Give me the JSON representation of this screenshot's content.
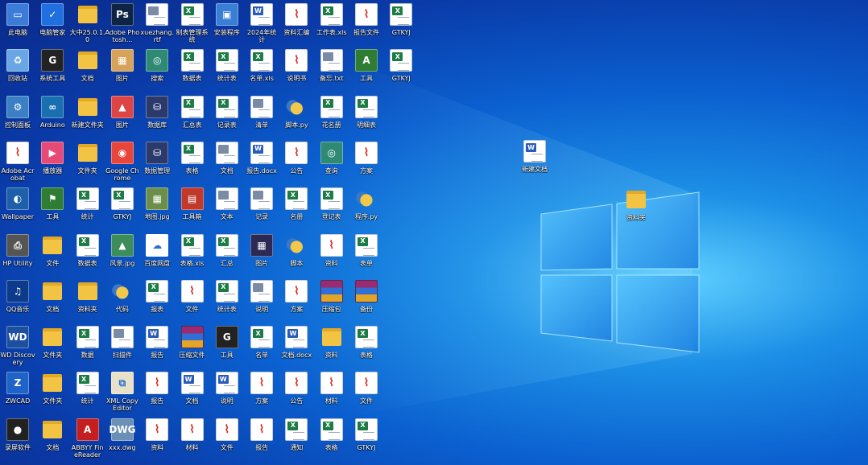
{
  "desktop": {
    "grid": [
      [
        {
          "label": "此电脑",
          "icon": "computer-icon",
          "kind": "app",
          "bg": "#3d7bd9",
          "sym": "▭"
        },
        {
          "label": "电脑管家",
          "icon": "shield-icon",
          "kind": "app",
          "bg": "#1f6fe0",
          "sym": "✓"
        },
        {
          "label": "大中25.0.1.0",
          "icon": "folder-icon",
          "kind": "folder"
        },
        {
          "label": "Adobe Photosh...",
          "icon": "photoshop-icon",
          "kind": "app",
          "bg": "#0e2444",
          "sym": "Ps"
        },
        {
          "label": "xuezhang.rtf",
          "icon": "document-icon",
          "kind": "doc",
          "badge": "",
          "badgeColor": "#7a8ba6"
        },
        {
          "label": "制表管理系统",
          "icon": "excel-icon",
          "kind": "doc",
          "badge": "X",
          "badgeColor": "#1d7c45"
        },
        {
          "label": "安装程序",
          "icon": "installer-icon",
          "kind": "app",
          "bg": "#3a7fd6",
          "sym": "▣"
        },
        {
          "label": "2024年统计",
          "icon": "word-icon",
          "kind": "doc",
          "badge": "W",
          "badgeColor": "#2b5bb8"
        },
        {
          "label": "资料汇编",
          "icon": "pdf-icon",
          "kind": "pdf"
        },
        {
          "label": "工作表.xls",
          "icon": "excel-icon",
          "kind": "doc",
          "badge": "X",
          "badgeColor": "#1d7c45"
        },
        {
          "label": "报告文件",
          "icon": "pdf-icon",
          "kind": "pdf"
        },
        {
          "label": "GTKYJ",
          "icon": "excel-icon",
          "kind": "doc",
          "badge": "X",
          "badgeColor": "#1d7c45"
        }
      ],
      [
        {
          "label": "回收站",
          "icon": "recycle-bin-icon",
          "kind": "app",
          "bg": "#6aa6e6",
          "sym": "♻"
        },
        {
          "label": "系统工具",
          "icon": "tool-icon",
          "kind": "app",
          "bg": "#222",
          "sym": "G"
        },
        {
          "label": "文档",
          "icon": "folder-icon",
          "kind": "folder"
        },
        {
          "label": "图片",
          "icon": "image-icon",
          "kind": "app",
          "bg": "#d7a35a",
          "sym": "▦"
        },
        {
          "label": "搜索",
          "icon": "search-icon",
          "kind": "app",
          "bg": "#2f8a74",
          "sym": "◎"
        },
        {
          "label": "数据表",
          "icon": "excel-icon",
          "kind": "doc",
          "badge": "X",
          "badgeColor": "#1d7c45"
        },
        {
          "label": "统计表",
          "icon": "excel-icon",
          "kind": "doc",
          "badge": "X",
          "badgeColor": "#1d7c45"
        },
        {
          "label": "名单.xls",
          "icon": "excel-icon",
          "kind": "doc",
          "badge": "X",
          "badgeColor": "#1d7c45"
        },
        {
          "label": "说明书",
          "icon": "pdf-icon",
          "kind": "pdf"
        },
        {
          "label": "备忘.txt",
          "icon": "text-icon",
          "kind": "doc",
          "badge": "",
          "badgeColor": "#7a8ba6"
        },
        {
          "label": "工具",
          "icon": "app-icon",
          "kind": "app",
          "bg": "#2e7d32",
          "sym": "A"
        },
        {
          "label": "GTKYJ",
          "icon": "excel-icon",
          "kind": "doc",
          "badge": "X",
          "badgeColor": "#1d7c45"
        }
      ],
      [
        {
          "label": "控制面板",
          "icon": "control-panel-icon",
          "kind": "app",
          "bg": "#3b7fc4",
          "sym": "⚙"
        },
        {
          "label": "Arduino",
          "icon": "infinity-icon",
          "kind": "app",
          "bg": "#1a6fb0",
          "sym": "∞"
        },
        {
          "label": "新建文件夹",
          "icon": "folder-icon",
          "kind": "folder"
        },
        {
          "label": "图片",
          "icon": "image-icon",
          "kind": "app",
          "bg": "#d44",
          "sym": "▲"
        },
        {
          "label": "数据库",
          "icon": "database-icon",
          "kind": "app",
          "bg": "#2b3a6b",
          "sym": "⛁"
        },
        {
          "label": "汇总表",
          "icon": "excel-icon",
          "kind": "doc",
          "badge": "X",
          "badgeColor": "#1d7c45"
        },
        {
          "label": "记录表",
          "icon": "excel-icon",
          "kind": "doc",
          "badge": "X",
          "badgeColor": "#1d7c45"
        },
        {
          "label": "清单",
          "icon": "document-icon",
          "kind": "doc",
          "badge": "",
          "badgeColor": "#7a8ba6"
        },
        {
          "label": "脚本.py",
          "icon": "python-icon",
          "kind": "py"
        },
        {
          "label": "花名册",
          "icon": "excel-icon",
          "kind": "doc",
          "badge": "X",
          "badgeColor": "#1d7c45"
        },
        {
          "label": "明细表",
          "icon": "excel-icon",
          "kind": "doc",
          "badge": "X",
          "badgeColor": "#1d7c45"
        }
      ],
      [
        {
          "label": "Adobe Acrobat",
          "icon": "acrobat-icon",
          "kind": "pdf"
        },
        {
          "label": "播放器",
          "icon": "player-icon",
          "kind": "app",
          "bg": "#e84a78",
          "sym": "▶"
        },
        {
          "label": "文件夹",
          "icon": "folder-icon",
          "kind": "folder"
        },
        {
          "label": "Google Chrome",
          "icon": "chrome-icon",
          "kind": "app",
          "bg": "#e8453c",
          "sym": "◉"
        },
        {
          "label": "数据管理",
          "icon": "database-icon",
          "kind": "app",
          "bg": "#2b3a6b",
          "sym": "⛁"
        },
        {
          "label": "表格",
          "icon": "excel-icon",
          "kind": "doc",
          "badge": "X",
          "badgeColor": "#1d7c45"
        },
        {
          "label": "文档",
          "icon": "document-icon",
          "kind": "doc",
          "badge": "",
          "badgeColor": "#7a8ba6"
        },
        {
          "label": "报告.docx",
          "icon": "word-icon",
          "kind": "doc",
          "badge": "W",
          "badgeColor": "#2b5bb8"
        },
        {
          "label": "公告",
          "icon": "pdf-icon",
          "kind": "pdf"
        },
        {
          "label": "查询",
          "icon": "search-icon",
          "kind": "app",
          "bg": "#2f8a74",
          "sym": "◎"
        },
        {
          "label": "方案",
          "icon": "pdf-icon",
          "kind": "pdf"
        }
      ],
      [
        {
          "label": "Wallpaper",
          "icon": "wallpaper-icon",
          "kind": "app",
          "bg": "#1d5fa8",
          "sym": "◐"
        },
        {
          "label": "工具",
          "icon": "app-icon",
          "kind": "app",
          "bg": "#2e7d32",
          "sym": "⚑"
        },
        {
          "label": "统计",
          "icon": "excel-icon",
          "kind": "doc",
          "badge": "X",
          "badgeColor": "#1d7c45"
        },
        {
          "label": "GTKYJ",
          "icon": "excel-icon",
          "kind": "doc",
          "badge": "X",
          "badgeColor": "#1d7c45"
        },
        {
          "label": "地图.jpg",
          "icon": "image-icon",
          "kind": "app",
          "bg": "#6b8f4a",
          "sym": "▦"
        },
        {
          "label": "工具箱",
          "icon": "toolbox-icon",
          "kind": "app",
          "bg": "#c0392b",
          "sym": "▤"
        },
        {
          "label": "文本",
          "icon": "document-icon",
          "kind": "doc",
          "badge": "",
          "badgeColor": "#7a8ba6"
        },
        {
          "label": "记录",
          "icon": "document-icon",
          "kind": "doc",
          "badge": "",
          "badgeColor": "#7a8ba6"
        },
        {
          "label": "名册",
          "icon": "excel-icon",
          "kind": "doc",
          "badge": "X",
          "badgeColor": "#1d7c45"
        },
        {
          "label": "登记表",
          "icon": "excel-icon",
          "kind": "doc",
          "badge": "X",
          "badgeColor": "#1d7c45"
        },
        {
          "label": "程序.py",
          "icon": "python-icon",
          "kind": "py"
        }
      ],
      [
        {
          "label": "HP Utility",
          "icon": "printer-icon",
          "kind": "app",
          "bg": "#555",
          "sym": "⎙"
        },
        {
          "label": "文件",
          "icon": "folder-icon",
          "kind": "folder"
        },
        {
          "label": "数据表",
          "icon": "excel-icon",
          "kind": "doc",
          "badge": "X",
          "badgeColor": "#1d7c45"
        },
        {
          "label": "风景.jpg",
          "icon": "image-icon",
          "kind": "app",
          "bg": "#3c8d5a",
          "sym": "▲"
        },
        {
          "label": "百度网盘",
          "icon": "cloud-icon",
          "kind": "app",
          "bg": "#fff",
          "sym": "☁"
        },
        {
          "label": "表格.xls",
          "icon": "excel-icon",
          "kind": "doc",
          "badge": "X",
          "badgeColor": "#1d7c45"
        },
        {
          "label": "汇总",
          "icon": "excel-icon",
          "kind": "doc",
          "badge": "X",
          "badgeColor": "#1d7c45"
        },
        {
          "label": "图片",
          "icon": "image-icon",
          "kind": "app",
          "bg": "#2a2a55",
          "sym": "▦"
        },
        {
          "label": "脚本",
          "icon": "python-icon",
          "kind": "py"
        },
        {
          "label": "资料",
          "icon": "pdf-icon",
          "kind": "pdf"
        },
        {
          "label": "表单",
          "icon": "excel-icon",
          "kind": "doc",
          "badge": "X",
          "badgeColor": "#1d7c45"
        }
      ],
      [
        {
          "label": "QQ音乐",
          "icon": "music-icon",
          "kind": "app",
          "bg": "#0b3b8a",
          "sym": "♫"
        },
        {
          "label": "文档",
          "icon": "folder-icon",
          "kind": "folder"
        },
        {
          "label": "资料夹",
          "icon": "folder-icon",
          "kind": "folder"
        },
        {
          "label": "代码",
          "icon": "python-icon",
          "kind": "py"
        },
        {
          "label": "报表",
          "icon": "excel-icon",
          "kind": "doc",
          "badge": "X",
          "badgeColor": "#1d7c45"
        },
        {
          "label": "文件",
          "icon": "pdf-icon",
          "kind": "pdf"
        },
        {
          "label": "统计表",
          "icon": "excel-icon",
          "kind": "doc",
          "badge": "X",
          "badgeColor": "#1d7c45"
        },
        {
          "label": "说明",
          "icon": "document-icon",
          "kind": "doc",
          "badge": "",
          "badgeColor": "#7a8ba6"
        },
        {
          "label": "方案",
          "icon": "pdf-icon",
          "kind": "pdf"
        },
        {
          "label": "压缩包",
          "icon": "zip-icon",
          "kind": "zip"
        },
        {
          "label": "备份",
          "icon": "zip-icon",
          "kind": "zip"
        }
      ],
      [
        {
          "label": "WD Discovery",
          "icon": "wd-icon",
          "kind": "app",
          "bg": "#1c4fa0",
          "sym": "WD"
        },
        {
          "label": "文件夹",
          "icon": "folder-icon",
          "kind": "folder"
        },
        {
          "label": "数据",
          "icon": "excel-icon",
          "kind": "doc",
          "badge": "X",
          "badgeColor": "#1d7c45"
        },
        {
          "label": "扫描件",
          "icon": "document-icon",
          "kind": "doc",
          "badge": "",
          "badgeColor": "#7a8ba6"
        },
        {
          "label": "报告",
          "icon": "word-icon",
          "kind": "doc",
          "badge": "W",
          "badgeColor": "#2b5bb8"
        },
        {
          "label": "压缩文件",
          "icon": "zip-icon",
          "kind": "zip"
        },
        {
          "label": "工具",
          "icon": "tool-icon",
          "kind": "app",
          "bg": "#222",
          "sym": "G"
        },
        {
          "label": "名单",
          "icon": "excel-icon",
          "kind": "doc",
          "badge": "X",
          "badgeColor": "#1d7c45"
        },
        {
          "label": "文档.docx",
          "icon": "word-icon",
          "kind": "doc",
          "badge": "W",
          "badgeColor": "#2b5bb8"
        },
        {
          "label": "资料",
          "icon": "folder-icon",
          "kind": "folder"
        },
        {
          "label": "表格",
          "icon": "excel-icon",
          "kind": "doc",
          "badge": "X",
          "badgeColor": "#1d7c45"
        }
      ],
      [
        {
          "label": "ZWCAD",
          "icon": "cad-icon",
          "kind": "app",
          "bg": "#1e63c8",
          "sym": "Z"
        },
        {
          "label": "文件夹",
          "icon": "folder-icon",
          "kind": "folder"
        },
        {
          "label": "统计",
          "icon": "excel-icon",
          "kind": "doc",
          "badge": "X",
          "badgeColor": "#1d7c45"
        },
        {
          "label": "XML Copy Editor",
          "icon": "editor-icon",
          "kind": "app",
          "bg": "#e9e0c8",
          "sym": "⧉"
        },
        {
          "label": "报告",
          "icon": "pdf-icon",
          "kind": "pdf"
        },
        {
          "label": "文档",
          "icon": "word-icon",
          "kind": "doc",
          "badge": "W",
          "badgeColor": "#2b5bb8"
        },
        {
          "label": "说明",
          "icon": "word-icon",
          "kind": "doc",
          "badge": "W",
          "badgeColor": "#2b5bb8"
        },
        {
          "label": "方案",
          "icon": "pdf-icon",
          "kind": "pdf"
        },
        {
          "label": "公告",
          "icon": "pdf-icon",
          "kind": "pdf"
        },
        {
          "label": "材料",
          "icon": "pdf-icon",
          "kind": "pdf"
        },
        {
          "label": "文件",
          "icon": "pdf-icon",
          "kind": "pdf"
        }
      ],
      [
        {
          "label": "录屏软件",
          "icon": "recorder-icon",
          "kind": "app",
          "bg": "#222",
          "sym": "●"
        },
        {
          "label": "文档",
          "icon": "folder-icon",
          "kind": "folder"
        },
        {
          "label": "ABBYY FineReader",
          "icon": "abbyy-icon",
          "kind": "app",
          "bg": "#c41e1e",
          "sym": "A"
        },
        {
          "label": "xxx.dwg",
          "icon": "dwg-icon",
          "kind": "app",
          "bg": "#6c8fb5",
          "sym": "DWG"
        },
        {
          "label": "资料",
          "icon": "pdf-icon",
          "kind": "pdf"
        },
        {
          "label": "材料",
          "icon": "pdf-icon",
          "kind": "pdf"
        },
        {
          "label": "文件",
          "icon": "pdf-icon",
          "kind": "pdf"
        },
        {
          "label": "报告",
          "icon": "pdf-icon",
          "kind": "pdf"
        },
        {
          "label": "通知",
          "icon": "excel-icon",
          "kind": "doc",
          "badge": "X",
          "badgeColor": "#1d7c45"
        },
        {
          "label": "表格",
          "icon": "excel-icon",
          "kind": "doc",
          "badge": "X",
          "badgeColor": "#1d7c45"
        },
        {
          "label": "GTKYJ",
          "icon": "excel-icon",
          "kind": "doc",
          "badge": "X",
          "badgeColor": "#1d7c45"
        }
      ]
    ],
    "floating": [
      {
        "label": "新建文档",
        "icon": "word-icon",
        "kind": "doc",
        "badge": "W",
        "badgeColor": "#2b5bb8",
        "pos": "right-1"
      },
      {
        "label": "资料夹",
        "icon": "folder-icon",
        "kind": "folder",
        "pos": "right-2"
      }
    ]
  }
}
